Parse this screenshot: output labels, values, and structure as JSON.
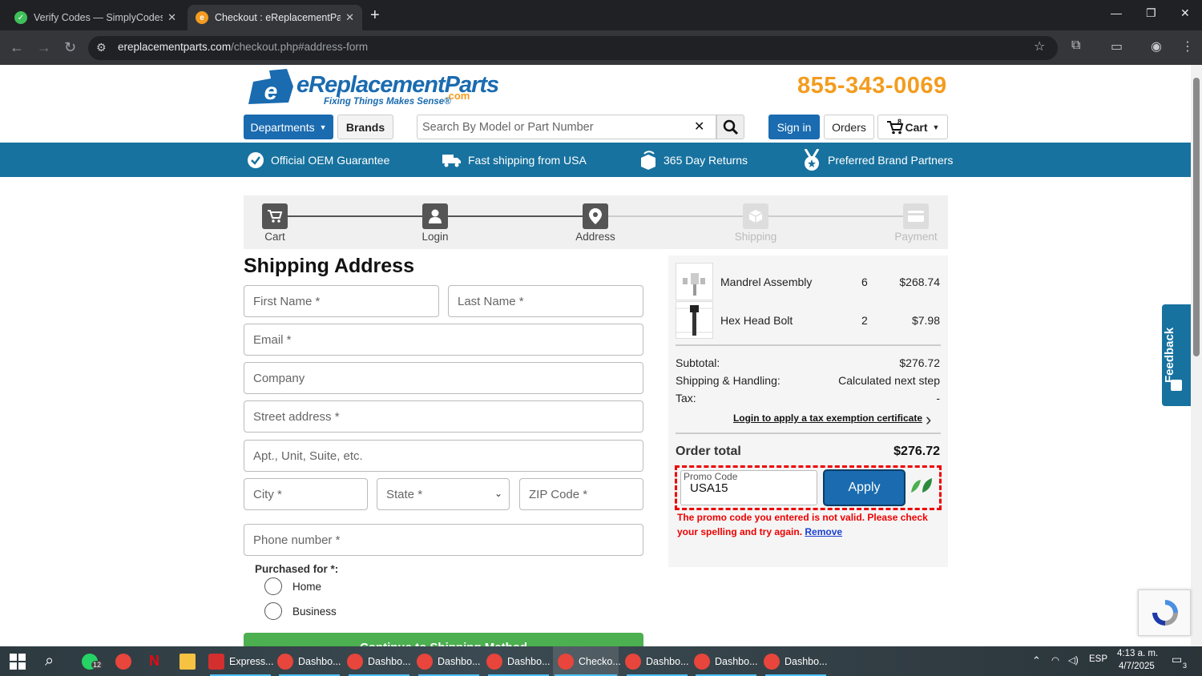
{
  "browser": {
    "tabs": [
      {
        "title": "Verify Codes — SimplyCodes",
        "active": false
      },
      {
        "title": "Checkout : eReplacementParts.c",
        "active": true
      }
    ],
    "url_host": "ereplacementparts.com",
    "url_path": "/checkout.php#address-form"
  },
  "site": {
    "logo_main": "eReplacementParts",
    "logo_com": ".com",
    "logo_tagline": "Fixing Things Makes Sense®",
    "phone": "855-343-0069",
    "nav": {
      "departments": "Departments",
      "brands": "Brands",
      "search_placeholder": "Search By Model or Part Number",
      "sign_in": "Sign in",
      "orders": "Orders",
      "cart": "Cart",
      "cart_count": "8"
    },
    "benefits": [
      "Official OEM Guarantee",
      "Fast shipping from USA",
      "365 Day Returns",
      "Preferred Brand Partners"
    ],
    "brand_colors": {
      "primary": "#1a6bb0",
      "banner": "#17729f",
      "accent": "#f39c1f"
    }
  },
  "checkout": {
    "steps": [
      {
        "label": "Cart",
        "icon": "cart-icon",
        "state": "done"
      },
      {
        "label": "Login",
        "icon": "user-icon",
        "state": "done"
      },
      {
        "label": "Address",
        "icon": "map-pin-icon",
        "state": "current"
      },
      {
        "label": "Shipping",
        "icon": "box-icon",
        "state": "pending"
      },
      {
        "label": "Payment",
        "icon": "card-icon",
        "state": "pending"
      }
    ],
    "title": "Shipping Address",
    "fields": {
      "first_name": "First Name *",
      "last_name": "Last Name *",
      "email": "Email *",
      "company": "Company",
      "street": "Street address *",
      "apt": "Apt., Unit, Suite, etc.",
      "city": "City *",
      "state": "State *",
      "zip": "ZIP Code *",
      "phone": "Phone number *"
    },
    "purchased_for_label": "Purchased for *:",
    "purchased_options": [
      "Home",
      "Business"
    ],
    "continue_label": "Continue to Shipping Method"
  },
  "summary": {
    "items": [
      {
        "name": "Mandrel Assembly",
        "qty": "6",
        "price": "$268.74"
      },
      {
        "name": "Hex Head Bolt",
        "qty": "2",
        "price": "$7.98"
      }
    ],
    "subtotal_label": "Subtotal:",
    "subtotal": "$276.72",
    "shipping_label": "Shipping & Handling:",
    "shipping": "Calculated next step",
    "tax_label": "Tax:",
    "tax": "-",
    "tax_link": "Login to apply a tax exemption certificate",
    "total_label": "Order total",
    "total": "$276.72",
    "promo": {
      "label": "Promo Code",
      "value": "USA15",
      "apply": "Apply",
      "error": "The promo code you entered is not valid. Please check your spelling and try again.",
      "remove": "Remove"
    }
  },
  "feedback_label": "Feedback",
  "taskbar": {
    "whatsapp_badge": "12",
    "apps": [
      "Express...",
      "Dashbo...",
      "Dashbo...",
      "Dashbo...",
      "Dashbo...",
      "Checko...",
      "Dashbo...",
      "Dashbo...",
      "Dashbo..."
    ],
    "language": "ESP",
    "time": "4:13 a. m.",
    "date": "4/7/2025",
    "notifications": "3"
  }
}
